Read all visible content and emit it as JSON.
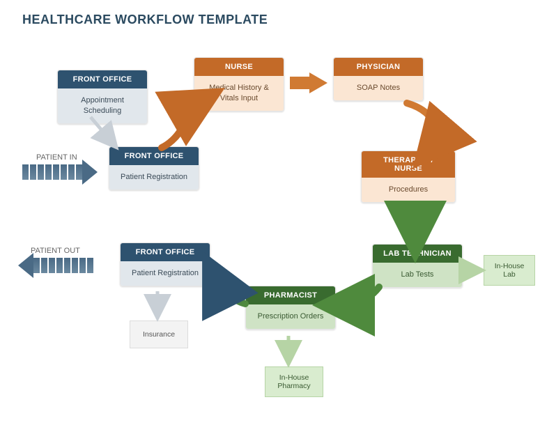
{
  "title": "HEALTHCARE WORKFLOW TEMPLATE",
  "labels": {
    "patient_in": "PATIENT IN",
    "patient_out": "PATIENT OUT"
  },
  "nodes": {
    "front_office_appt": {
      "header": "FRONT OFFICE",
      "body": "Appointment Scheduling"
    },
    "nurse": {
      "header": "NURSE",
      "body": "Medical History & Vitals Input"
    },
    "physician": {
      "header": "PHYSICIAN",
      "body": "SOAP Notes"
    },
    "front_office_reg1": {
      "header": "FRONT OFFICE",
      "body": "Patient Registration"
    },
    "therapist_nurse": {
      "header": "THERAPIST / NURSE",
      "body": "Procedures"
    },
    "front_office_reg2": {
      "header": "FRONT OFFICE",
      "body": "Patient Registration"
    },
    "lab_tech": {
      "header": "LAB TECHNICIAN",
      "body": "Lab Tests"
    },
    "pharmacist": {
      "header": "PHARMACIST",
      "body": "Prescription Orders"
    }
  },
  "aux": {
    "insurance": "Insurance",
    "in_house_lab": "In-House Lab",
    "in_house_pharmacy": "In-House Pharmacy"
  }
}
